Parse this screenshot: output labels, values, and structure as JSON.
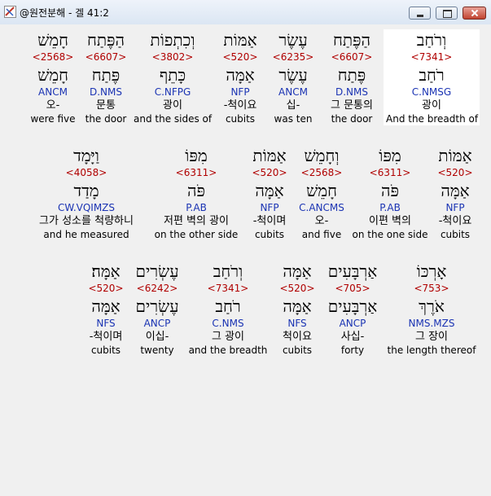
{
  "window": {
    "title": "@원전분해 - 겔 41:2"
  },
  "rows": [
    [
      {
        "hebrew": "וְרֹחַב",
        "strong": "<7341>",
        "lemma": "רֹחַב",
        "morph": "C.NMSG",
        "korean": "광이",
        "english": "And the breadth of",
        "selected": true
      },
      {
        "hebrew": "הַפֶּתַח",
        "strong": "<6607>",
        "lemma": "פֶּתַח",
        "morph": "D.NMS",
        "korean": "그 문통의",
        "english": "the door"
      },
      {
        "hebrew": "עֶשֶׂר",
        "strong": "<6235>",
        "lemma": "עֶשֶׂר",
        "morph": "ANCM",
        "korean": "십-",
        "english": "was ten"
      },
      {
        "hebrew": "אַמּוֹת",
        "strong": "<520>",
        "lemma": "אַמָּה",
        "morph": "NFP",
        "korean": "-척이요",
        "english": "cubits"
      },
      {
        "hebrew": "וְכִתְפוֹת",
        "strong": "<3802>",
        "lemma": "כָּתֵף",
        "morph": "C.NFPG",
        "korean": "광이",
        "english": "and the sides of"
      },
      {
        "hebrew": "הַפֶּתַח",
        "strong": "<6607>",
        "lemma": "פֶּתַח",
        "morph": "D.NMS",
        "korean": "문통",
        "english": "the door"
      },
      {
        "hebrew": "חָמֵשׁ",
        "strong": "<2568>",
        "lemma": "חָמֵשׁ",
        "morph": "ANCM",
        "korean": "오-",
        "english": "were five"
      }
    ],
    [
      {
        "hebrew": "אַמּוֹת",
        "strong": "<520>",
        "lemma": "אַמָּה",
        "morph": "NFP",
        "korean": "-척이요",
        "english": "cubits"
      },
      {
        "hebrew": "מִפּוֹ",
        "strong": "<6311>",
        "lemma": "פֹּה",
        "morph": "P.AB",
        "korean": "이편 벽의",
        "english": "on the one side"
      },
      {
        "hebrew": "וְחָמֵשׁ",
        "strong": "<2568>",
        "lemma": "חָמֵשׁ",
        "morph": "C.ANCMS",
        "korean": "오-",
        "english": "and five"
      },
      {
        "hebrew": "אַמּוֹת",
        "strong": "<520>",
        "lemma": "אַמָּה",
        "morph": "NFP",
        "korean": "-척이며",
        "english": "cubits"
      },
      {
        "hebrew": "מִפּוֹ",
        "strong": "<6311>",
        "lemma": "פֹּה",
        "morph": "P.AB",
        "korean": "저편 벽의 광이",
        "english": "on the other side"
      },
      {
        "hebrew": "וַיָּמָד",
        "strong": "<4058>",
        "lemma": "מָדַד",
        "morph": "CW.VQIMZS",
        "korean": "그가 성소를 척량하니",
        "english": "and he measured"
      }
    ],
    [
      {
        "hebrew": "אָרְכּוֹ",
        "strong": "<753>",
        "lemma": "אֹרֶךְ",
        "morph": "NMS.MZS",
        "korean": "그 장이",
        "english": "the length thereof"
      },
      {
        "hebrew": "אַרְבָּעִים",
        "strong": "<705>",
        "lemma": "אַרְבָּעִים",
        "morph": "ANCP",
        "korean": "사십-",
        "english": "forty"
      },
      {
        "hebrew": "אַמָּה",
        "strong": "<520>",
        "lemma": "אַמָּה",
        "morph": "NFS",
        "korean": "척이요",
        "english": "cubits"
      },
      {
        "hebrew": "וְרֹחַב",
        "strong": "<7341>",
        "lemma": "רֹחַב",
        "morph": "C.NMS",
        "korean": "그 광이",
        "english": "and the breadth"
      },
      {
        "hebrew": "עֶשְׂרִים",
        "strong": "<6242>",
        "lemma": "עֶשְׂרִים",
        "morph": "ANCP",
        "korean": "이십-",
        "english": "twenty"
      },
      {
        "hebrew": "אַמָּה׃",
        "strong": "<520>",
        "lemma": "אַמָּה",
        "morph": "NFS",
        "korean": "-척이며",
        "english": "cubits"
      }
    ]
  ]
}
